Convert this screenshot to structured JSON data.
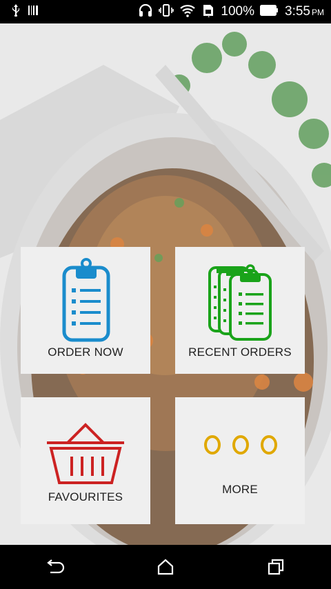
{
  "status_bar": {
    "battery_percent": "100%",
    "time": "3:55",
    "ampm": "PM",
    "icons": [
      "usb-icon",
      "barcode-icon",
      "headset-icon",
      "vibrate-icon",
      "wifi-icon",
      "sim-icon",
      "battery-icon"
    ]
  },
  "tiles": {
    "order_now": {
      "label": "ORDER NOW",
      "icon": "clipboard-list-icon",
      "color": "#1a8ccc"
    },
    "recent_orders": {
      "label": "RECENT ORDERS",
      "icon": "stacked-clipboards-icon",
      "color": "#1aa31a"
    },
    "favourites": {
      "label": "FAVOURITES",
      "icon": "basket-icon",
      "color": "#cc2222"
    },
    "more": {
      "label": "MORE",
      "icon": "three-dots-icon",
      "color": "#e0a800"
    }
  },
  "nav": {
    "icons": [
      "back-icon",
      "home-icon",
      "recent-apps-icon"
    ]
  }
}
